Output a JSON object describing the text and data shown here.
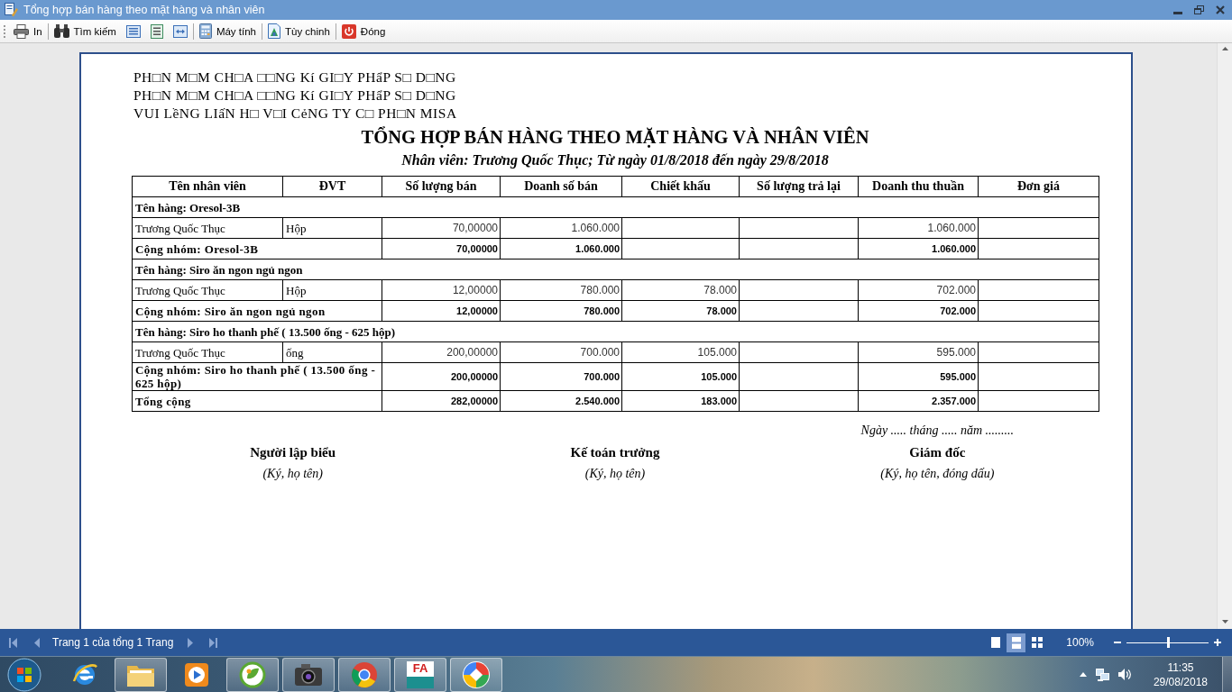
{
  "window": {
    "title": "Tổng hợp bán hàng theo mặt hàng và nhân viên"
  },
  "toolbar": {
    "groups": [
      [
        {
          "kind": "print",
          "label": "In"
        }
      ],
      [
        {
          "kind": "search",
          "label": "Tìm kiếm"
        },
        {
          "kind": "page"
        },
        {
          "kind": "page-framed"
        },
        {
          "kind": "page-width"
        }
      ],
      [
        {
          "kind": "calculator",
          "label": "Máy tính"
        }
      ],
      [
        {
          "kind": "customize",
          "label": "Tùy chinh"
        }
      ],
      [
        {
          "kind": "close",
          "label": "Đóng"
        }
      ]
    ]
  },
  "report": {
    "notice_lines": [
      "PH□N M□M CH□A □□NG Kí GI□Y PHẩP S□ D□NG",
      "PH□N M□M CH□A □□NG Kí GI□Y PHẩP S□ D□NG",
      "VUI LềNG LIấN H□ V□I CẻNG TY C□ PH□N MISA"
    ],
    "title": "TỔNG HỢP BÁN HÀNG THEO MẶT HÀNG VÀ NHÂN VIÊN",
    "subtitle": "Nhân viên: Trương Quốc Thục; Từ ngày 01/8/2018 đến ngày 29/8/2018",
    "table": {
      "columns": [
        "Tên nhân viên",
        "ĐVT",
        "Số lượng bán",
        "Doanh số bán",
        "Chiết khấu",
        "Số lượng trả lại",
        "Doanh thu thuần",
        "Đơn giá"
      ],
      "rows": [
        {
          "kind": "group",
          "label": "Tên hàng: Oresol-3B"
        },
        {
          "kind": "detail",
          "employee": "Trương Quốc Thục",
          "unit": "Hộp",
          "quantity": "70,00000",
          "sales": "1.060.000",
          "net_revenue": "1.060.000"
        },
        {
          "kind": "subtotal",
          "label": "Cộng nhóm: Oresol-3B",
          "quantity": "70,00000",
          "sales": "1.060.000",
          "net_revenue": "1.060.000"
        },
        {
          "kind": "group",
          "label": "Tên hàng: Siro ăn ngon ngủ ngon"
        },
        {
          "kind": "detail",
          "employee": "Trương Quốc Thục",
          "unit": "Hộp",
          "quantity": "12,00000",
          "sales": "780.000",
          "discount": "78.000",
          "net_revenue": "702.000"
        },
        {
          "kind": "subtotal",
          "label": "Cộng nhóm: Siro ăn ngon ngủ ngon",
          "quantity": "12,00000",
          "sales": "780.000",
          "discount": "78.000",
          "net_revenue": "702.000"
        },
        {
          "kind": "group",
          "label": "Tên hàng: Siro ho thanh phế ( 13.500 ống - 625 hộp)"
        },
        {
          "kind": "detail",
          "employee": "Trương Quốc Thục",
          "unit": "ống",
          "quantity": "200,00000",
          "sales": "700.000",
          "discount": "105.000",
          "net_revenue": "595.000"
        },
        {
          "kind": "subtotal",
          "label": "Cộng nhóm: Siro ho thanh phế ( 13.500 ống - 625 hộp)",
          "quantity": "200,00000",
          "sales": "700.000",
          "discount": "105.000",
          "net_revenue": "595.000"
        },
        {
          "kind": "total",
          "label": "Tổng cộng",
          "quantity": "282,00000",
          "sales": "2.540.000",
          "discount": "183.000",
          "net_revenue": "2.357.000"
        }
      ]
    },
    "date_line": "Ngày ..... tháng ..... năm .........",
    "signatures": [
      {
        "title": "Người lập biểu",
        "note": "(Ký, họ tên)"
      },
      {
        "title": "Kế toán trưởng",
        "note": "(Ký, họ tên)"
      },
      {
        "title": "Giám đốc",
        "note": "(Ký, họ tên, đóng dấu)"
      }
    ]
  },
  "pager": {
    "text": "Trang 1 của tổng 1 Trang"
  },
  "view_modes": [
    {
      "kind": "single",
      "selected": false
    },
    {
      "kind": "double",
      "selected": true
    },
    {
      "kind": "grid",
      "selected": false
    }
  ],
  "zoom": {
    "reading": "100%",
    "level": 0.5
  },
  "taskbar": {
    "apps": [
      {
        "kind": "browser-e",
        "running": false
      },
      {
        "kind": "folder",
        "running": true
      },
      {
        "kind": "player",
        "running": false
      },
      {
        "kind": "leaf",
        "running": true
      },
      {
        "kind": "camera",
        "running": true
      },
      {
        "kind": "tricolor",
        "running": true
      },
      {
        "kind": "logo-tile",
        "label": "FA",
        "running": true
      },
      {
        "kind": "pinwheel",
        "running": true
      }
    ],
    "time": "11:35",
    "date": "29/08/2018"
  }
}
